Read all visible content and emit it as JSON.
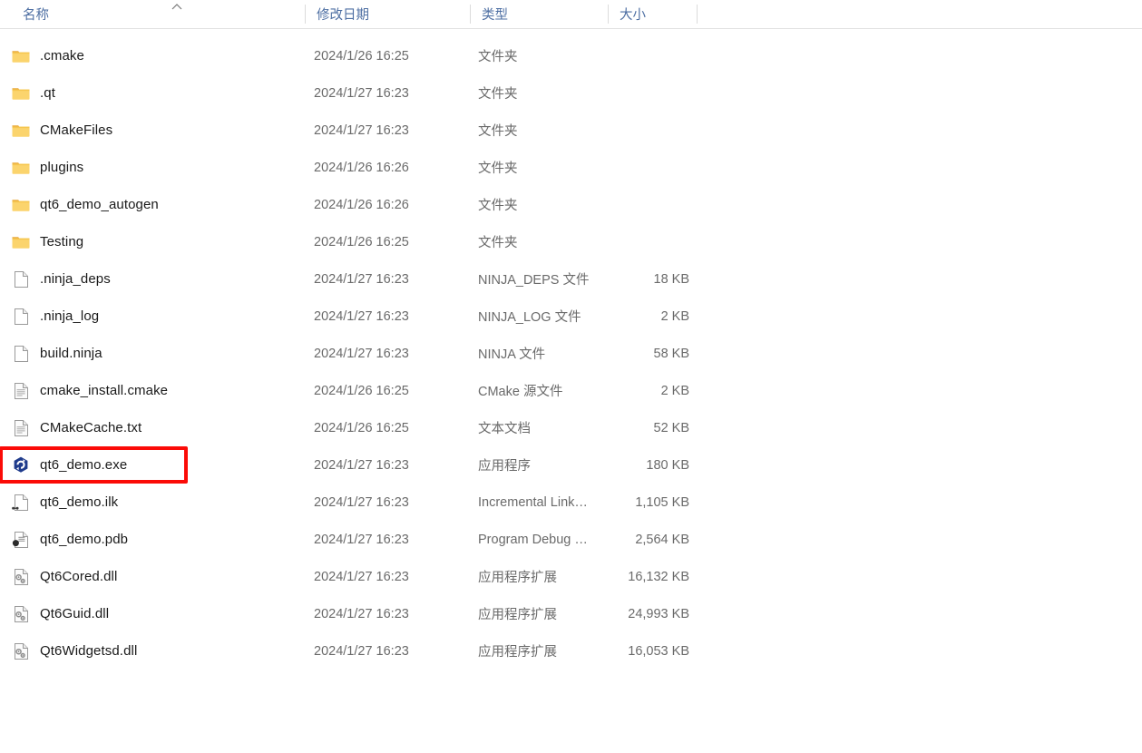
{
  "window": {
    "view": "file-explorer-details-view"
  },
  "columns": {
    "name": "名称",
    "date_modified": "修改日期",
    "type": "类型",
    "size": "大小",
    "sort_indicator": "ascending-sort-arrow",
    "sorted_by": "名称"
  },
  "highlight": {
    "color": "#fb0b07",
    "target": "qt6_demo.exe"
  },
  "files": [
    {
      "name": ".cmake",
      "date": "2024/1/26 16:25",
      "type": "文件夹",
      "size": "",
      "icon": "folder-icon"
    },
    {
      "name": ".qt",
      "date": "2024/1/27 16:23",
      "type": "文件夹",
      "size": "",
      "icon": "folder-icon"
    },
    {
      "name": "CMakeFiles",
      "date": "2024/1/27 16:23",
      "type": "文件夹",
      "size": "",
      "icon": "folder-icon"
    },
    {
      "name": "plugins",
      "date": "2024/1/26 16:26",
      "type": "文件夹",
      "size": "",
      "icon": "folder-icon"
    },
    {
      "name": "qt6_demo_autogen",
      "date": "2024/1/26 16:26",
      "type": "文件夹",
      "size": "",
      "icon": "folder-icon"
    },
    {
      "name": "Testing",
      "date": "2024/1/26 16:25",
      "type": "文件夹",
      "size": "",
      "icon": "folder-icon"
    },
    {
      "name": ".ninja_deps",
      "date": "2024/1/27 16:23",
      "type": "NINJA_DEPS 文件",
      "size": "18 KB",
      "icon": "blank-page-icon"
    },
    {
      "name": ".ninja_log",
      "date": "2024/1/27 16:23",
      "type": "NINJA_LOG 文件",
      "size": "2 KB",
      "icon": "blank-page-icon"
    },
    {
      "name": "build.ninja",
      "date": "2024/1/27 16:23",
      "type": "NINJA 文件",
      "size": "58 KB",
      "icon": "blank-page-icon"
    },
    {
      "name": "cmake_install.cmake",
      "date": "2024/1/26 16:25",
      "type": "CMake 源文件",
      "size": "2 KB",
      "icon": "text-page-icon"
    },
    {
      "name": "CMakeCache.txt",
      "date": "2024/1/26 16:25",
      "type": "文本文档",
      "size": "52 KB",
      "icon": "text-page-icon"
    },
    {
      "name": "qt6_demo.exe",
      "date": "2024/1/27 16:23",
      "type": "应用程序",
      "size": "180 KB",
      "icon": "qt-app-icon"
    },
    {
      "name": "qt6_demo.ilk",
      "date": "2024/1/27 16:23",
      "type": "Incremental Link…",
      "size": "1,105 KB",
      "icon": "link-page-icon"
    },
    {
      "name": "qt6_demo.pdb",
      "date": "2024/1/27 16:23",
      "type": "Program Debug …",
      "size": "2,564 KB",
      "icon": "debug-page-icon"
    },
    {
      "name": "Qt6Cored.dll",
      "date": "2024/1/27 16:23",
      "type": "应用程序扩展",
      "size": "16,132 KB",
      "icon": "gear-page-icon"
    },
    {
      "name": "Qt6Guid.dll",
      "date": "2024/1/27 16:23",
      "type": "应用程序扩展",
      "size": "24,993 KB",
      "icon": "gear-page-icon"
    },
    {
      "name": "Qt6Widgetsd.dll",
      "date": "2024/1/27 16:23",
      "type": "应用程序扩展",
      "size": "16,053 KB",
      "icon": "gear-page-icon"
    }
  ]
}
